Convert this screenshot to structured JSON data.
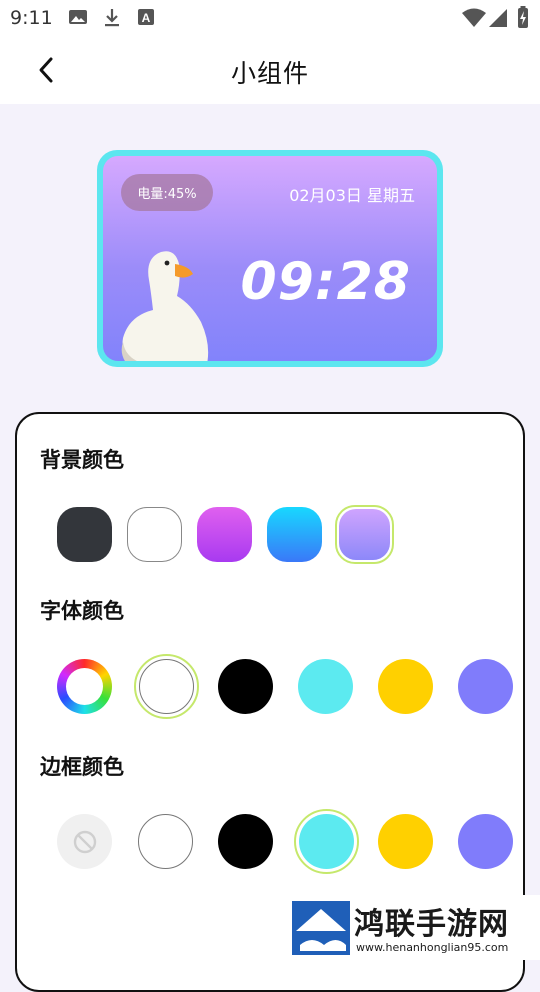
{
  "status": {
    "time": "9:11"
  },
  "header": {
    "title": "小组件"
  },
  "preview": {
    "battery": "电量:45%",
    "date": "02月03日 星期五",
    "clock": "09:28",
    "border_color": "#5ce6ef"
  },
  "sections": {
    "background": {
      "title": "背景颜色",
      "colors": [
        "#33363b",
        "#ffffff",
        "#c040f0",
        "#1e88f5",
        "#a48cf9"
      ],
      "selected_index": 4
    },
    "font": {
      "title": "字体颜色",
      "colors": [
        "color-wheel",
        "#ffffff",
        "#000000",
        "#5ceaf0",
        "#ffd000",
        "#807cfb"
      ],
      "selected_index": 1
    },
    "border": {
      "title": "边框颜色",
      "colors": [
        "none",
        "#ffffff",
        "#000000",
        "#5ceaf0",
        "#ffd000",
        "#807cfb"
      ],
      "selected_index": 3
    }
  },
  "watermark": {
    "name": "鸿联手游网",
    "url": "www.henanhonglian95.com"
  }
}
